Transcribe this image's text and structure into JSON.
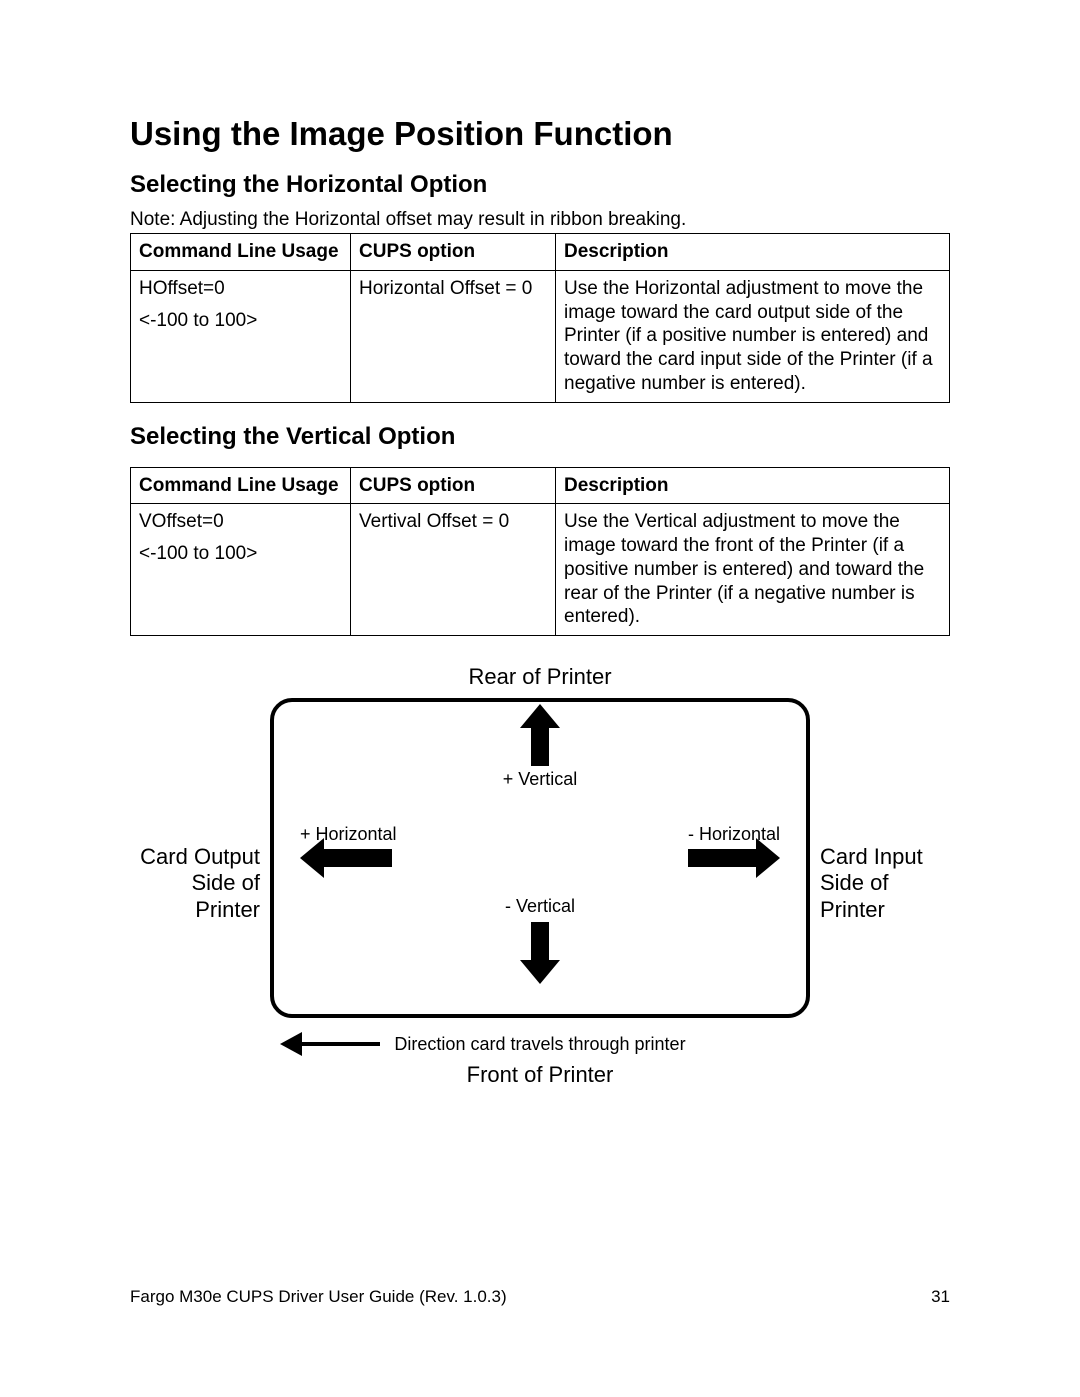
{
  "title": "Using the Image Position Function",
  "section1": {
    "heading": "Selecting the Horizontal Option",
    "note": "Note: Adjusting the Horizontal offset may result in ribbon breaking.",
    "headers": {
      "c1": "Command Line Usage",
      "c2": "CUPS option",
      "c3": "Description"
    },
    "row": {
      "cmd": "HOffset=0",
      "range": "<-100 to 100>",
      "cups": "Horizontal Offset = 0",
      "desc": "Use the Horizontal adjustment to move the image toward the card output side of the Printer (if a positive number is entered) and toward the card input side of the Printer (if a negative number is entered)."
    }
  },
  "section2": {
    "heading": "Selecting the Vertical Option",
    "headers": {
      "c1": "Command Line Usage",
      "c2": "CUPS option",
      "c3": "Description"
    },
    "row": {
      "cmd": "VOffset=0",
      "range": "<-100 to 100>",
      "cups": "Vertival Offset = 0",
      "desc": "Use the Vertical adjustment to move the image toward the front of the Printer (if a positive number is entered) and toward the rear of the Printer (if a negative number is entered)."
    }
  },
  "diagram": {
    "rear": "Rear of Printer",
    "front": "Front of Printer",
    "left_out_l1": "Card Output",
    "left_out_l2": "Side of Printer",
    "right_out_l1": "Card Input",
    "right_out_l2": "Side of Printer",
    "plus_v": "+ Vertical",
    "minus_v": "- Vertical",
    "plus_h": "+ Horizontal",
    "minus_h": "- Horizontal",
    "direction": "Direction card travels through printer"
  },
  "footer": {
    "left": "Fargo M30e CUPS Driver User Guide (Rev. 1.0.3)",
    "right": "31"
  }
}
